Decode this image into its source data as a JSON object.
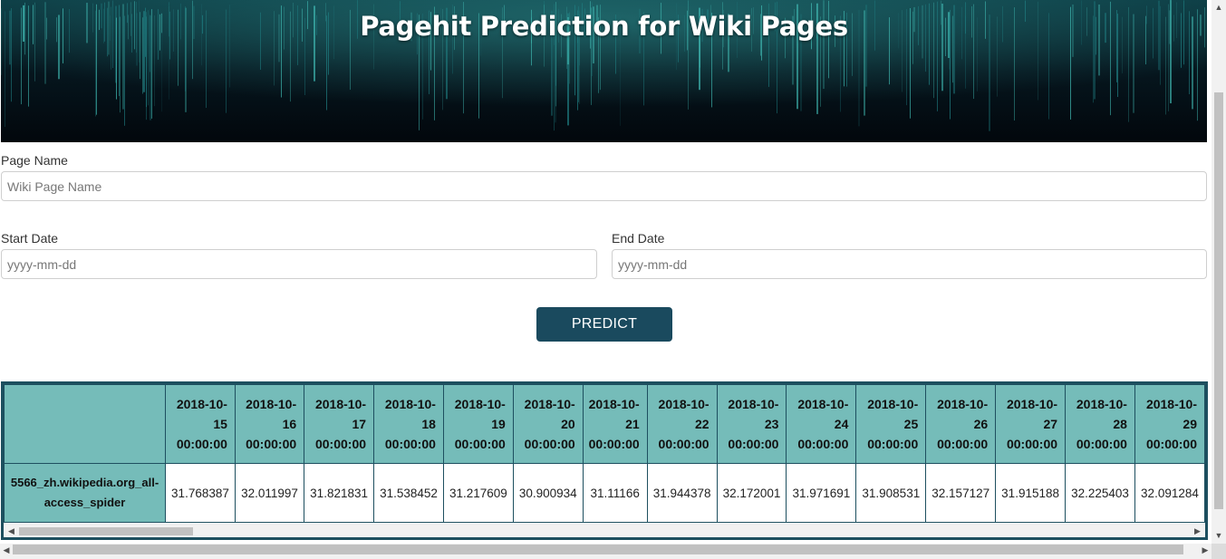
{
  "banner": {
    "title": "Pagehit Prediction for Wiki Pages"
  },
  "form": {
    "page_name": {
      "label": "Page Name",
      "placeholder": "Wiki Page Name"
    },
    "start_date": {
      "label": "Start Date",
      "placeholder": "yyyy-mm-dd"
    },
    "end_date": {
      "label": "End Date",
      "placeholder": "yyyy-mm-dd"
    },
    "predict_label": "PREDICT"
  },
  "results": {
    "columns": [
      [
        "2018-10-",
        "15",
        "00:00:00"
      ],
      [
        "2018-10-",
        "16",
        "00:00:00"
      ],
      [
        "2018-10-",
        "17",
        "00:00:00"
      ],
      [
        "2018-10-",
        "18",
        "00:00:00"
      ],
      [
        "2018-10-",
        "19",
        "00:00:00"
      ],
      [
        "2018-10-",
        "20",
        "00:00:00"
      ],
      [
        "2018-10-",
        "21",
        "00:00:00"
      ],
      [
        "2018-10-",
        "22",
        "00:00:00"
      ],
      [
        "2018-10-",
        "23",
        "00:00:00"
      ],
      [
        "2018-10-",
        "24",
        "00:00:00"
      ],
      [
        "2018-10-",
        "25",
        "00:00:00"
      ],
      [
        "2018-10-",
        "26",
        "00:00:00"
      ],
      [
        "2018-10-",
        "27",
        "00:00:00"
      ],
      [
        "2018-10-",
        "28",
        "00:00:00"
      ],
      [
        "2018-10-",
        "29",
        "00:00:00"
      ]
    ],
    "rows": [
      {
        "label": [
          "5566_zh.wikipedia.org_all-",
          "access_spider"
        ],
        "values": [
          "31.768387",
          "32.011997",
          "31.821831",
          "31.538452",
          "31.217609",
          "30.900934",
          "31.11166",
          "31.944378",
          "32.172001",
          "31.971691",
          "31.908531",
          "32.157127",
          "31.915188",
          "32.225403",
          "32.091284"
        ]
      }
    ]
  },
  "colors": {
    "banner_bg": "#030a10",
    "accent_teal": "#75bcb9",
    "button_bg": "#1a4a5e",
    "table_border": "#1d4f5f"
  },
  "icons": {
    "scroll_left": "◀",
    "scroll_right": "▶",
    "scroll_up": "▲",
    "scroll_down": "▼"
  }
}
